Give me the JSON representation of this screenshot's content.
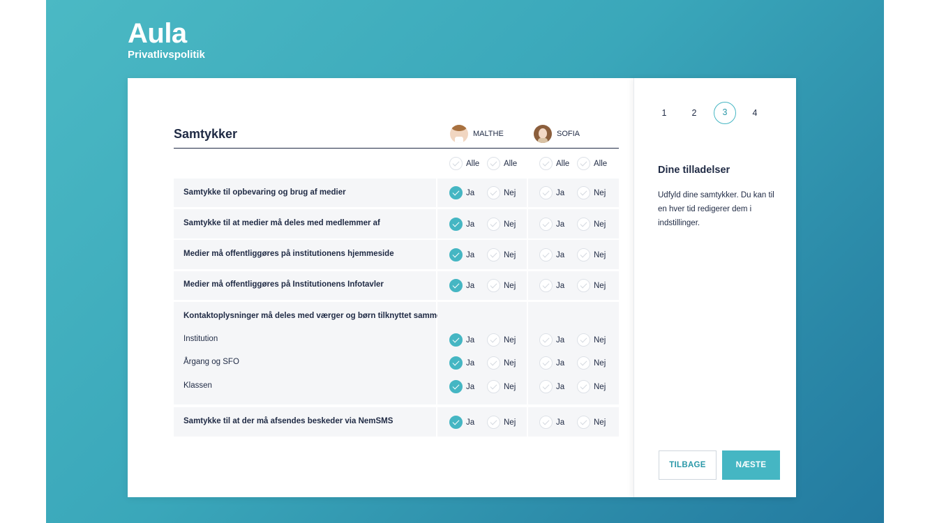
{
  "brand": {
    "logo": "Aula",
    "subtitle": "Privatlivspolitik"
  },
  "consent": {
    "title": "Samtykker",
    "children": [
      {
        "name": "MALTHE"
      },
      {
        "name": "SOFIA"
      }
    ],
    "all_label": "Alle",
    "yes_label": "Ja",
    "no_label": "Nej",
    "questions": [
      {
        "text": "Samtykke til opbevaring og brug af medier"
      },
      {
        "text": "Samtykke til at medier må deles med medlemmer af"
      },
      {
        "text": "Medier må offentliggøres på institutionens hjemmeside"
      },
      {
        "text": "Medier må offentliggøres på Institutionens Infotavler"
      },
      {
        "text": "Kontaktoplysninger må deles med værger og børn tilknyttet samme:",
        "subitems": [
          {
            "text": "Institution"
          },
          {
            "text": "Årgang og SFO"
          },
          {
            "text": "Klassen"
          }
        ]
      },
      {
        "text": "Samtykke til at der må afsendes beskeder via NemSMS"
      }
    ]
  },
  "sidebar": {
    "steps": [
      "1",
      "2",
      "3",
      "4"
    ],
    "active_step": "3",
    "title": "Dine tilladelser",
    "text": "Udfyld dine samtykker. Du kan til en hver tid redigerer dem i indstillinger.",
    "back_label": "TILBAGE",
    "next_label": "NÆSTE"
  },
  "colors": {
    "accent": "#45b6c3",
    "text": "#1f2a44",
    "row_bg": "#f5f6f8"
  }
}
